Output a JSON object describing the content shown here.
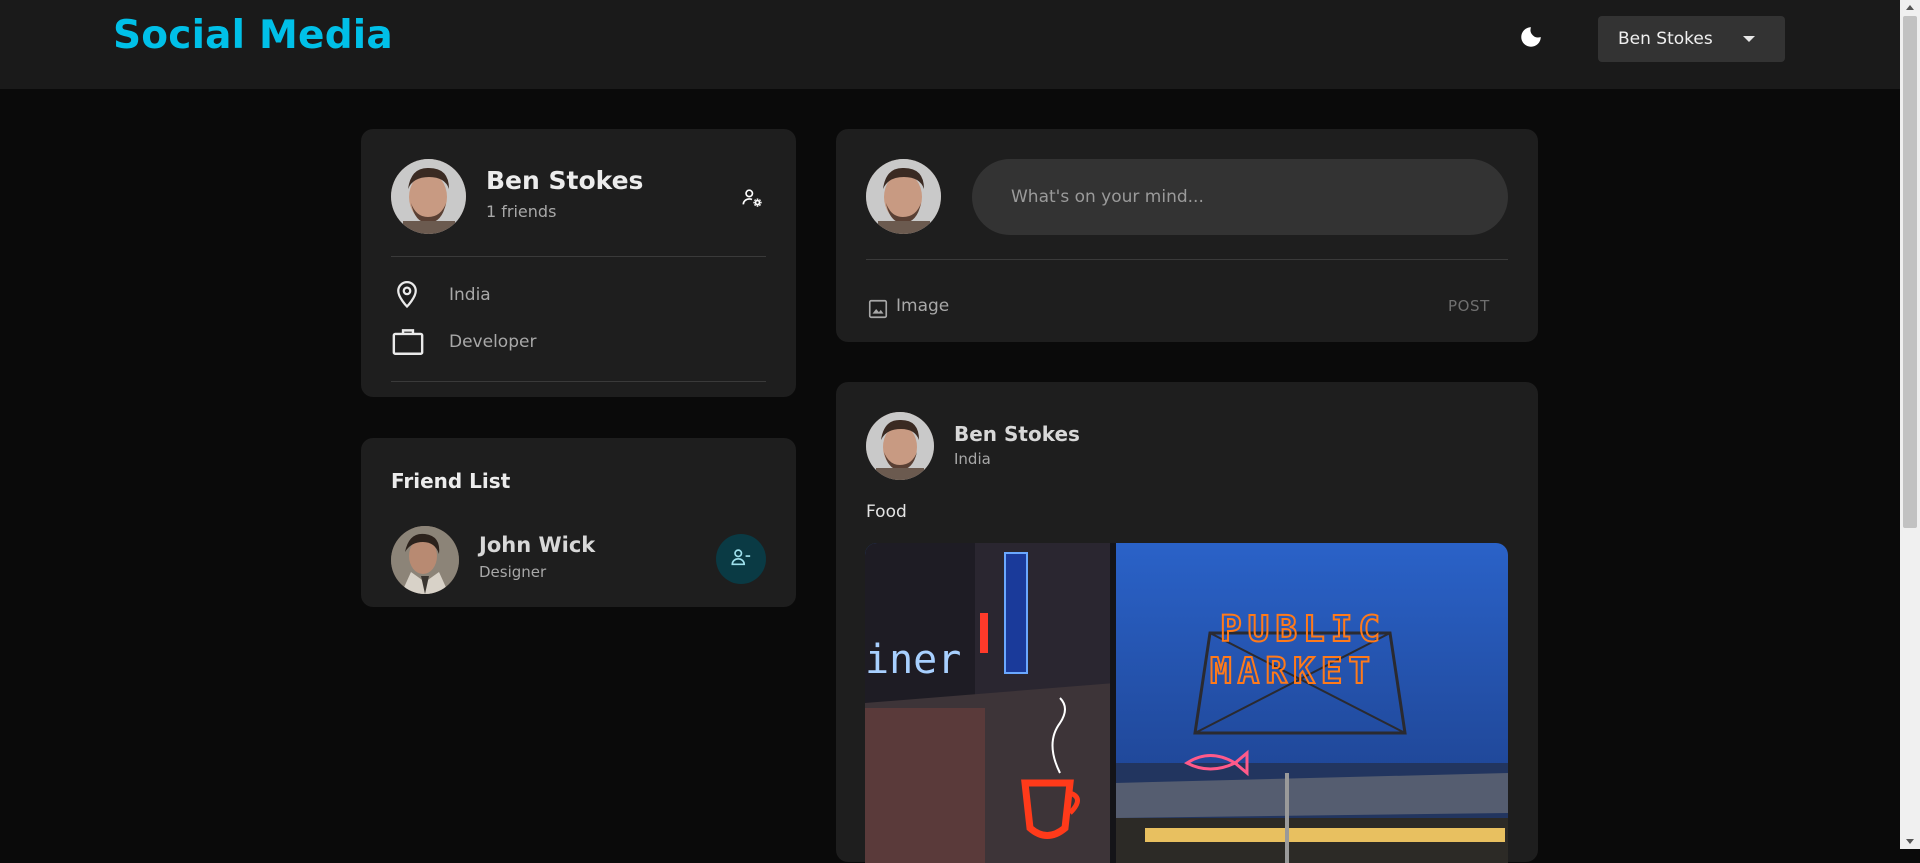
{
  "app": {
    "brand": "Social Media"
  },
  "header": {
    "theme_icon": "moon-icon",
    "user_select": {
      "selected": "Ben Stokes",
      "icon": "caret-down-icon"
    }
  },
  "profile": {
    "name": "Ben Stokes",
    "friends_count": "1 friends",
    "manage_icon": "manage-account-icon",
    "location": "India",
    "location_icon": "location-pin-icon",
    "occupation": "Developer",
    "occupation_icon": "briefcase-icon"
  },
  "friend_list": {
    "title": "Friend List",
    "friends": [
      {
        "name": "John Wick",
        "occupation": "Designer",
        "action_icon": "remove-friend-icon"
      }
    ]
  },
  "composer": {
    "placeholder": "What's on your mind...",
    "image_label": "Image",
    "image_icon": "image-icon",
    "post_label": "POST"
  },
  "feed": {
    "posts": [
      {
        "author": "Ben Stokes",
        "location": "India",
        "description": "Food",
        "image_sign_line1": "PUBLIC",
        "image_sign_line2": "MARKET",
        "image_sign_left": "iner"
      }
    ]
  },
  "colors": {
    "brand": "#00c0e8",
    "background": "#0a0a0a",
    "card": "#1e1e1e",
    "header": "#1a1a1a"
  }
}
